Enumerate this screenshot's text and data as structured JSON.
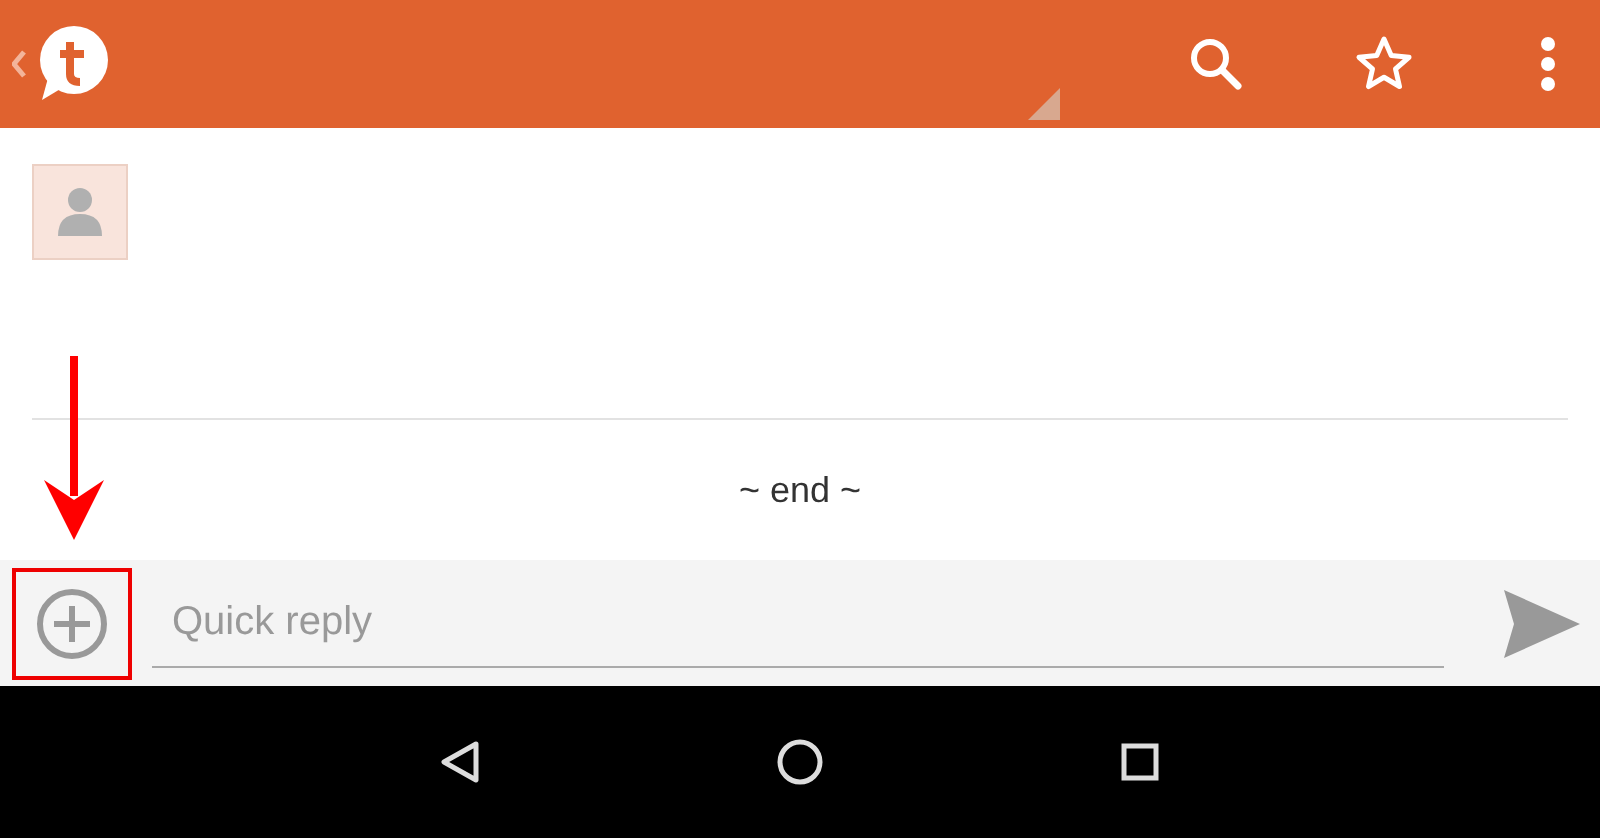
{
  "thread": {
    "end_marker": "~ end ~"
  },
  "reply": {
    "placeholder": "Quick reply"
  }
}
